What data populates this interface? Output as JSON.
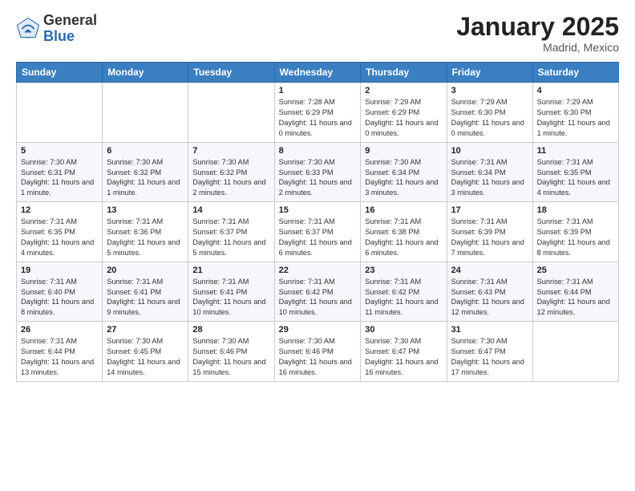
{
  "header": {
    "logo_general": "General",
    "logo_blue": "Blue",
    "month": "January 2025",
    "location": "Madrid, Mexico"
  },
  "days_of_week": [
    "Sunday",
    "Monday",
    "Tuesday",
    "Wednesday",
    "Thursday",
    "Friday",
    "Saturday"
  ],
  "weeks": [
    [
      {
        "day": "",
        "info": ""
      },
      {
        "day": "",
        "info": ""
      },
      {
        "day": "",
        "info": ""
      },
      {
        "day": "1",
        "info": "Sunrise: 7:28 AM\nSunset: 6:29 PM\nDaylight: 11 hours and 0 minutes."
      },
      {
        "day": "2",
        "info": "Sunrise: 7:29 AM\nSunset: 6:29 PM\nDaylight: 11 hours and 0 minutes."
      },
      {
        "day": "3",
        "info": "Sunrise: 7:29 AM\nSunset: 6:30 PM\nDaylight: 11 hours and 0 minutes."
      },
      {
        "day": "4",
        "info": "Sunrise: 7:29 AM\nSunset: 6:30 PM\nDaylight: 11 hours and 1 minute."
      }
    ],
    [
      {
        "day": "5",
        "info": "Sunrise: 7:30 AM\nSunset: 6:31 PM\nDaylight: 11 hours and 1 minute."
      },
      {
        "day": "6",
        "info": "Sunrise: 7:30 AM\nSunset: 6:32 PM\nDaylight: 11 hours and 1 minute."
      },
      {
        "day": "7",
        "info": "Sunrise: 7:30 AM\nSunset: 6:32 PM\nDaylight: 11 hours and 2 minutes."
      },
      {
        "day": "8",
        "info": "Sunrise: 7:30 AM\nSunset: 6:33 PM\nDaylight: 11 hours and 2 minutes."
      },
      {
        "day": "9",
        "info": "Sunrise: 7:30 AM\nSunset: 6:34 PM\nDaylight: 11 hours and 3 minutes."
      },
      {
        "day": "10",
        "info": "Sunrise: 7:31 AM\nSunset: 6:34 PM\nDaylight: 11 hours and 3 minutes."
      },
      {
        "day": "11",
        "info": "Sunrise: 7:31 AM\nSunset: 6:35 PM\nDaylight: 11 hours and 4 minutes."
      }
    ],
    [
      {
        "day": "12",
        "info": "Sunrise: 7:31 AM\nSunset: 6:35 PM\nDaylight: 11 hours and 4 minutes."
      },
      {
        "day": "13",
        "info": "Sunrise: 7:31 AM\nSunset: 6:36 PM\nDaylight: 11 hours and 5 minutes."
      },
      {
        "day": "14",
        "info": "Sunrise: 7:31 AM\nSunset: 6:37 PM\nDaylight: 11 hours and 5 minutes."
      },
      {
        "day": "15",
        "info": "Sunrise: 7:31 AM\nSunset: 6:37 PM\nDaylight: 11 hours and 6 minutes."
      },
      {
        "day": "16",
        "info": "Sunrise: 7:31 AM\nSunset: 6:38 PM\nDaylight: 11 hours and 6 minutes."
      },
      {
        "day": "17",
        "info": "Sunrise: 7:31 AM\nSunset: 6:39 PM\nDaylight: 11 hours and 7 minutes."
      },
      {
        "day": "18",
        "info": "Sunrise: 7:31 AM\nSunset: 6:39 PM\nDaylight: 11 hours and 8 minutes."
      }
    ],
    [
      {
        "day": "19",
        "info": "Sunrise: 7:31 AM\nSunset: 6:40 PM\nDaylight: 11 hours and 8 minutes."
      },
      {
        "day": "20",
        "info": "Sunrise: 7:31 AM\nSunset: 6:41 PM\nDaylight: 11 hours and 9 minutes."
      },
      {
        "day": "21",
        "info": "Sunrise: 7:31 AM\nSunset: 6:41 PM\nDaylight: 11 hours and 10 minutes."
      },
      {
        "day": "22",
        "info": "Sunrise: 7:31 AM\nSunset: 6:42 PM\nDaylight: 11 hours and 10 minutes."
      },
      {
        "day": "23",
        "info": "Sunrise: 7:31 AM\nSunset: 6:42 PM\nDaylight: 11 hours and 11 minutes."
      },
      {
        "day": "24",
        "info": "Sunrise: 7:31 AM\nSunset: 6:43 PM\nDaylight: 11 hours and 12 minutes."
      },
      {
        "day": "25",
        "info": "Sunrise: 7:31 AM\nSunset: 6:44 PM\nDaylight: 11 hours and 12 minutes."
      }
    ],
    [
      {
        "day": "26",
        "info": "Sunrise: 7:31 AM\nSunset: 6:44 PM\nDaylight: 11 hours and 13 minutes."
      },
      {
        "day": "27",
        "info": "Sunrise: 7:30 AM\nSunset: 6:45 PM\nDaylight: 11 hours and 14 minutes."
      },
      {
        "day": "28",
        "info": "Sunrise: 7:30 AM\nSunset: 6:46 PM\nDaylight: 11 hours and 15 minutes."
      },
      {
        "day": "29",
        "info": "Sunrise: 7:30 AM\nSunset: 6:46 PM\nDaylight: 11 hours and 16 minutes."
      },
      {
        "day": "30",
        "info": "Sunrise: 7:30 AM\nSunset: 6:47 PM\nDaylight: 11 hours and 16 minutes."
      },
      {
        "day": "31",
        "info": "Sunrise: 7:30 AM\nSunset: 6:47 PM\nDaylight: 11 hours and 17 minutes."
      },
      {
        "day": "",
        "info": ""
      }
    ]
  ]
}
